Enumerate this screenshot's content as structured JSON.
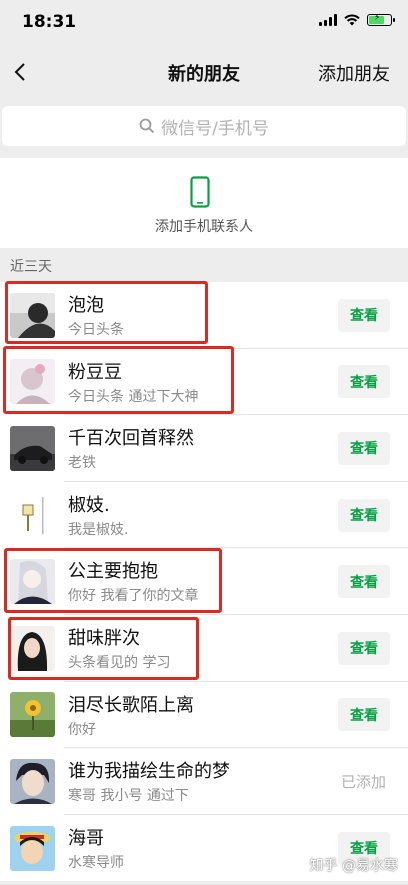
{
  "status_bar": {
    "time": "18:31"
  },
  "nav": {
    "title": "新的朋友",
    "action": "添加朋友"
  },
  "search": {
    "placeholder": "微信号/手机号"
  },
  "phone_contacts": {
    "label": "添加手机联系人"
  },
  "section": {
    "label": "近三天"
  },
  "friends": [
    {
      "name": "泡泡",
      "message": "今日头条",
      "action": "查看"
    },
    {
      "name": "粉豆豆",
      "message": "今日头条 通过下大神",
      "action": "查看"
    },
    {
      "name": "千百次回首释然",
      "message": "老铁",
      "action": "查看"
    },
    {
      "name": "椒妓.",
      "message": "我是椒妓.",
      "action": "查看"
    },
    {
      "name": "公主要抱抱",
      "message": "你好 我看了你的文章",
      "action": "查看"
    },
    {
      "name": "甜味胖次",
      "message": "头条看见的 学习",
      "action": "查看"
    },
    {
      "name": "泪尽长歌陌上离",
      "message": "你好",
      "action": "查看"
    },
    {
      "name": "谁为我描绘生命的梦",
      "message": "寒哥 我小号 通过下",
      "status": "已添加"
    },
    {
      "name": "海哥",
      "message": "水寒导师",
      "action": "查看"
    }
  ],
  "watermark": "知乎 @易水寒",
  "colors": {
    "accent": "#07a045",
    "highlight": "#d92a24",
    "background": "#ededed"
  }
}
